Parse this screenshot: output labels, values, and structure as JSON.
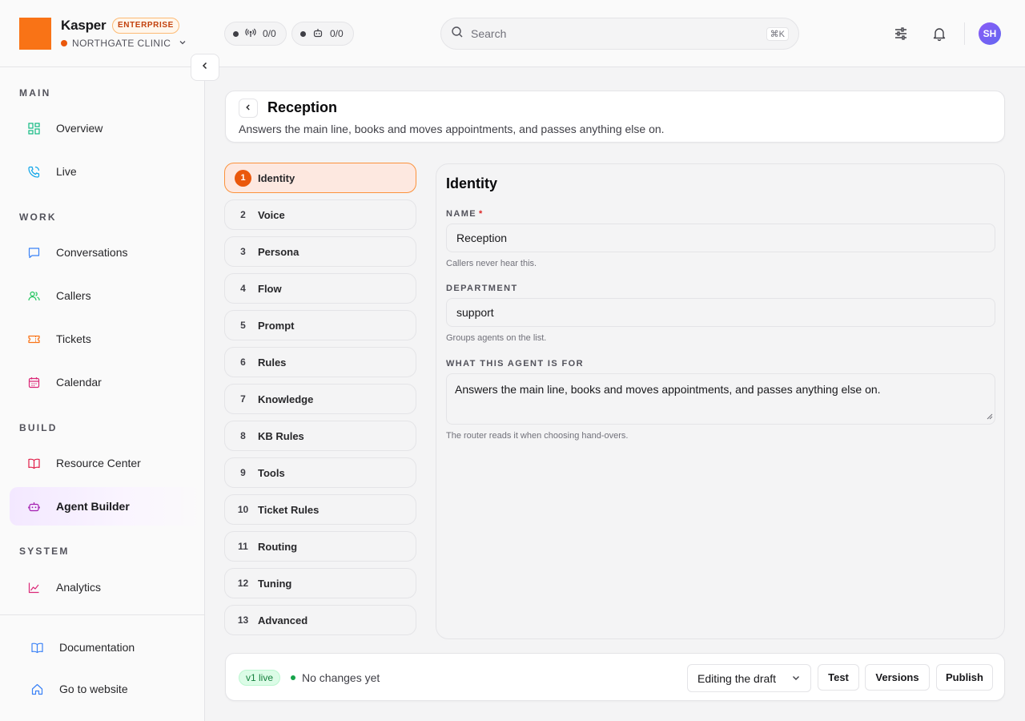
{
  "brand": {
    "name": "Kasper",
    "plan_badge": "ENTERPRISE",
    "org": "NORTHGATE CLINIC"
  },
  "counters": [
    {
      "icon": "broadcast-icon",
      "value": "0/0"
    },
    {
      "icon": "robot-icon",
      "value": "0/0"
    }
  ],
  "search": {
    "placeholder": "Search",
    "shortcut": "⌘K"
  },
  "user": {
    "initials": "SH"
  },
  "sidebar": {
    "sections": {
      "main": "MAIN",
      "work": "WORK",
      "build": "BUILD",
      "system": "SYSTEM"
    },
    "items": {
      "overview": "Overview",
      "live": "Live",
      "conversations": "Conversations",
      "callers": "Callers",
      "tickets": "Tickets",
      "calendar": "Calendar",
      "resource_center": "Resource Center",
      "agent_builder": "Agent Builder",
      "analytics": "Analytics"
    },
    "footer": {
      "documentation": "Documentation",
      "website": "Go to website"
    },
    "active": "Agent Builder"
  },
  "page": {
    "title": "Reception",
    "subtitle": "Answers the main line, books and moves appointments, and passes anything else on."
  },
  "steps": [
    {
      "num": "1",
      "label": "Identity"
    },
    {
      "num": "2",
      "label": "Voice"
    },
    {
      "num": "3",
      "label": "Persona"
    },
    {
      "num": "4",
      "label": "Flow"
    },
    {
      "num": "5",
      "label": "Prompt"
    },
    {
      "num": "6",
      "label": "Rules"
    },
    {
      "num": "7",
      "label": "Knowledge"
    },
    {
      "num": "8",
      "label": "KB Rules"
    },
    {
      "num": "9",
      "label": "Tools"
    },
    {
      "num": "10",
      "label": "Ticket Rules"
    },
    {
      "num": "11",
      "label": "Routing"
    },
    {
      "num": "12",
      "label": "Tuning"
    },
    {
      "num": "13",
      "label": "Advanced"
    }
  ],
  "form": {
    "title": "Identity",
    "name_label": "NAME",
    "name_required": "*",
    "name_value": "Reception",
    "name_help": "Callers never hear this.",
    "dept_label": "DEPARTMENT",
    "dept_value": "support",
    "dept_help": "Groups agents on the list.",
    "purpose_label": "WHAT THIS AGENT IS FOR",
    "purpose_value": "Answers the main line, books and moves appointments, and passes anything else on.",
    "purpose_help": "The router reads it when choosing hand-overs."
  },
  "footer_bar": {
    "version_badge": "v1 live",
    "status": "No changes yet",
    "mode": "Editing the draft",
    "test": "Test",
    "versions": "Versions",
    "publish": "Publish"
  },
  "colors": {
    "brand": "#f97316",
    "accent": "#ea580c",
    "live": "#16a34a",
    "active_nav": "#f3e8ff"
  }
}
